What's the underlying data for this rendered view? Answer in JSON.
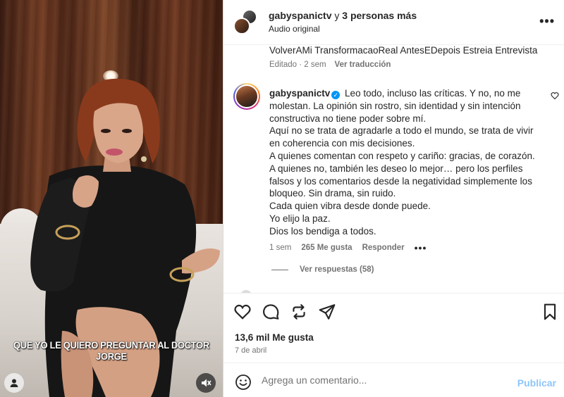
{
  "video": {
    "subtitle": "QUE YO LE QUIERO PREGUNTAR AL DOCTOR JORGE",
    "user_icon": "user-icon",
    "mute_icon": "mute-icon"
  },
  "header": {
    "username": "gabyspanictv",
    "collab_text": " y ",
    "collab_link": "3 personas más",
    "audio": "Audio original",
    "more_icon": "•••"
  },
  "caption": {
    "tags": "VolverAMi TransformacaoReal AntesEDepois Estreia Entrevista",
    "edited": "Editado · 2 sem",
    "translate": "Ver traducción"
  },
  "comment": {
    "username": "gabyspanictv",
    "verified_glyph": "✓",
    "lines": [
      "Leo todo, incluso las críticas. Y no, no me molestan. La opinión sin rostro, sin identidad y sin intención constructiva no tiene poder sobre mí.",
      "Aquí no se trata de agradarle a todo el mundo, se trata de vivir en coherencia con mis decisiones.",
      "A quienes comentan con respeto y cariño: gracias, de corazón.",
      "A quienes no, también les deseo lo mejor… pero los perfiles falsos y los comentarios desde la negatividad simplemente los bloqueo. Sin drama, sin ruido.",
      "Cada quien vibra desde donde puede.",
      "Yo elijo la paz.",
      "Dios los bendiga a todos."
    ],
    "time": "1 sem",
    "likes": "265 Me gusta",
    "reply": "Responder",
    "more": "•••",
    "view_replies": "Ver respuestas (58)"
  },
  "actions": {
    "likes": "13,6 mil Me gusta",
    "date": "7 de abril"
  },
  "compose": {
    "placeholder": "Agrega un comentario...",
    "publish": "Publicar"
  },
  "colors": {
    "accent": "#0095f6",
    "publish_disabled": "#8ec5fb",
    "secondary_text": "#737373"
  }
}
